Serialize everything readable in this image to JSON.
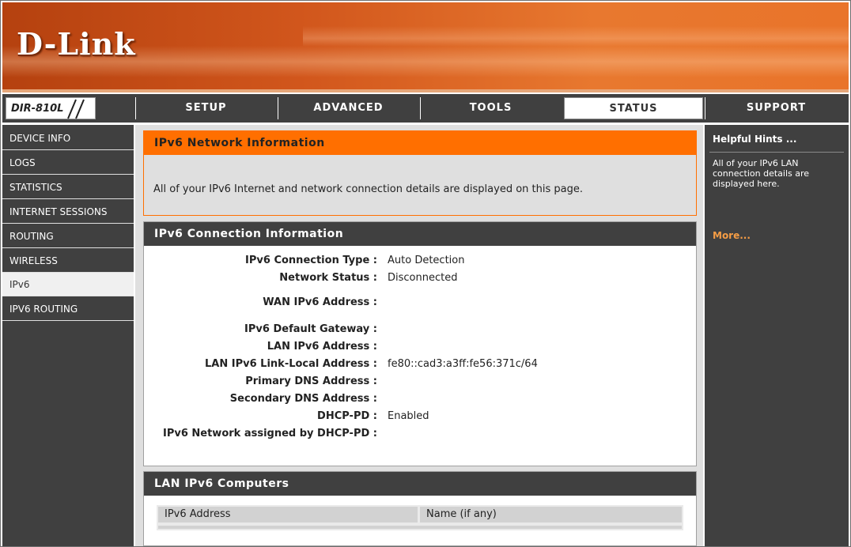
{
  "brand": {
    "logo_text": "D-Link",
    "model": "DIR-810L"
  },
  "tabs": [
    {
      "label": "SETUP"
    },
    {
      "label": "ADVANCED"
    },
    {
      "label": "TOOLS"
    },
    {
      "label": "STATUS",
      "active": true
    },
    {
      "label": "SUPPORT"
    }
  ],
  "sidebar": {
    "items": [
      {
        "label": "DEVICE INFO"
      },
      {
        "label": "LOGS"
      },
      {
        "label": "STATISTICS"
      },
      {
        "label": "INTERNET SESSIONS"
      },
      {
        "label": "ROUTING"
      },
      {
        "label": "WIRELESS"
      },
      {
        "label": "IPv6",
        "active": true
      },
      {
        "label": "IPV6 ROUTING"
      }
    ]
  },
  "network_info": {
    "title": "IPv6 Network Information",
    "description": "All of your IPv6 Internet and network connection details are displayed on this page."
  },
  "connection_info": {
    "title": "IPv6 Connection Information",
    "fields": [
      {
        "label": "IPv6 Connection Type :",
        "value": "Auto Detection"
      },
      {
        "label": "Network Status :",
        "value": "Disconnected"
      },
      {
        "label": "WAN IPv6 Address :",
        "value": ""
      },
      {
        "label": "IPv6 Default Gateway :",
        "value": ""
      },
      {
        "label": "LAN IPv6 Address :",
        "value": ""
      },
      {
        "label": "LAN IPv6 Link-Local Address :",
        "value": "fe80::cad3:a3ff:fe56:371c/64"
      },
      {
        "label": "Primary DNS Address :",
        "value": ""
      },
      {
        "label": "Secondary DNS Address :",
        "value": ""
      },
      {
        "label": "DHCP-PD :",
        "value": "Enabled"
      },
      {
        "label": "IPv6 Network assigned by DHCP-PD :",
        "value": ""
      }
    ]
  },
  "lan_computers": {
    "title": "LAN IPv6 Computers",
    "columns": [
      "IPv6 Address",
      "Name (if any)"
    ]
  },
  "hints": {
    "title": "Helpful Hints ...",
    "text": "All of your IPv6 LAN connection details are displayed here.",
    "more": "More..."
  },
  "colors": {
    "accent": "#ff6f00",
    "nav_bg": "#404040",
    "header_orange": "#d1561c",
    "more_link": "#f49c45"
  }
}
